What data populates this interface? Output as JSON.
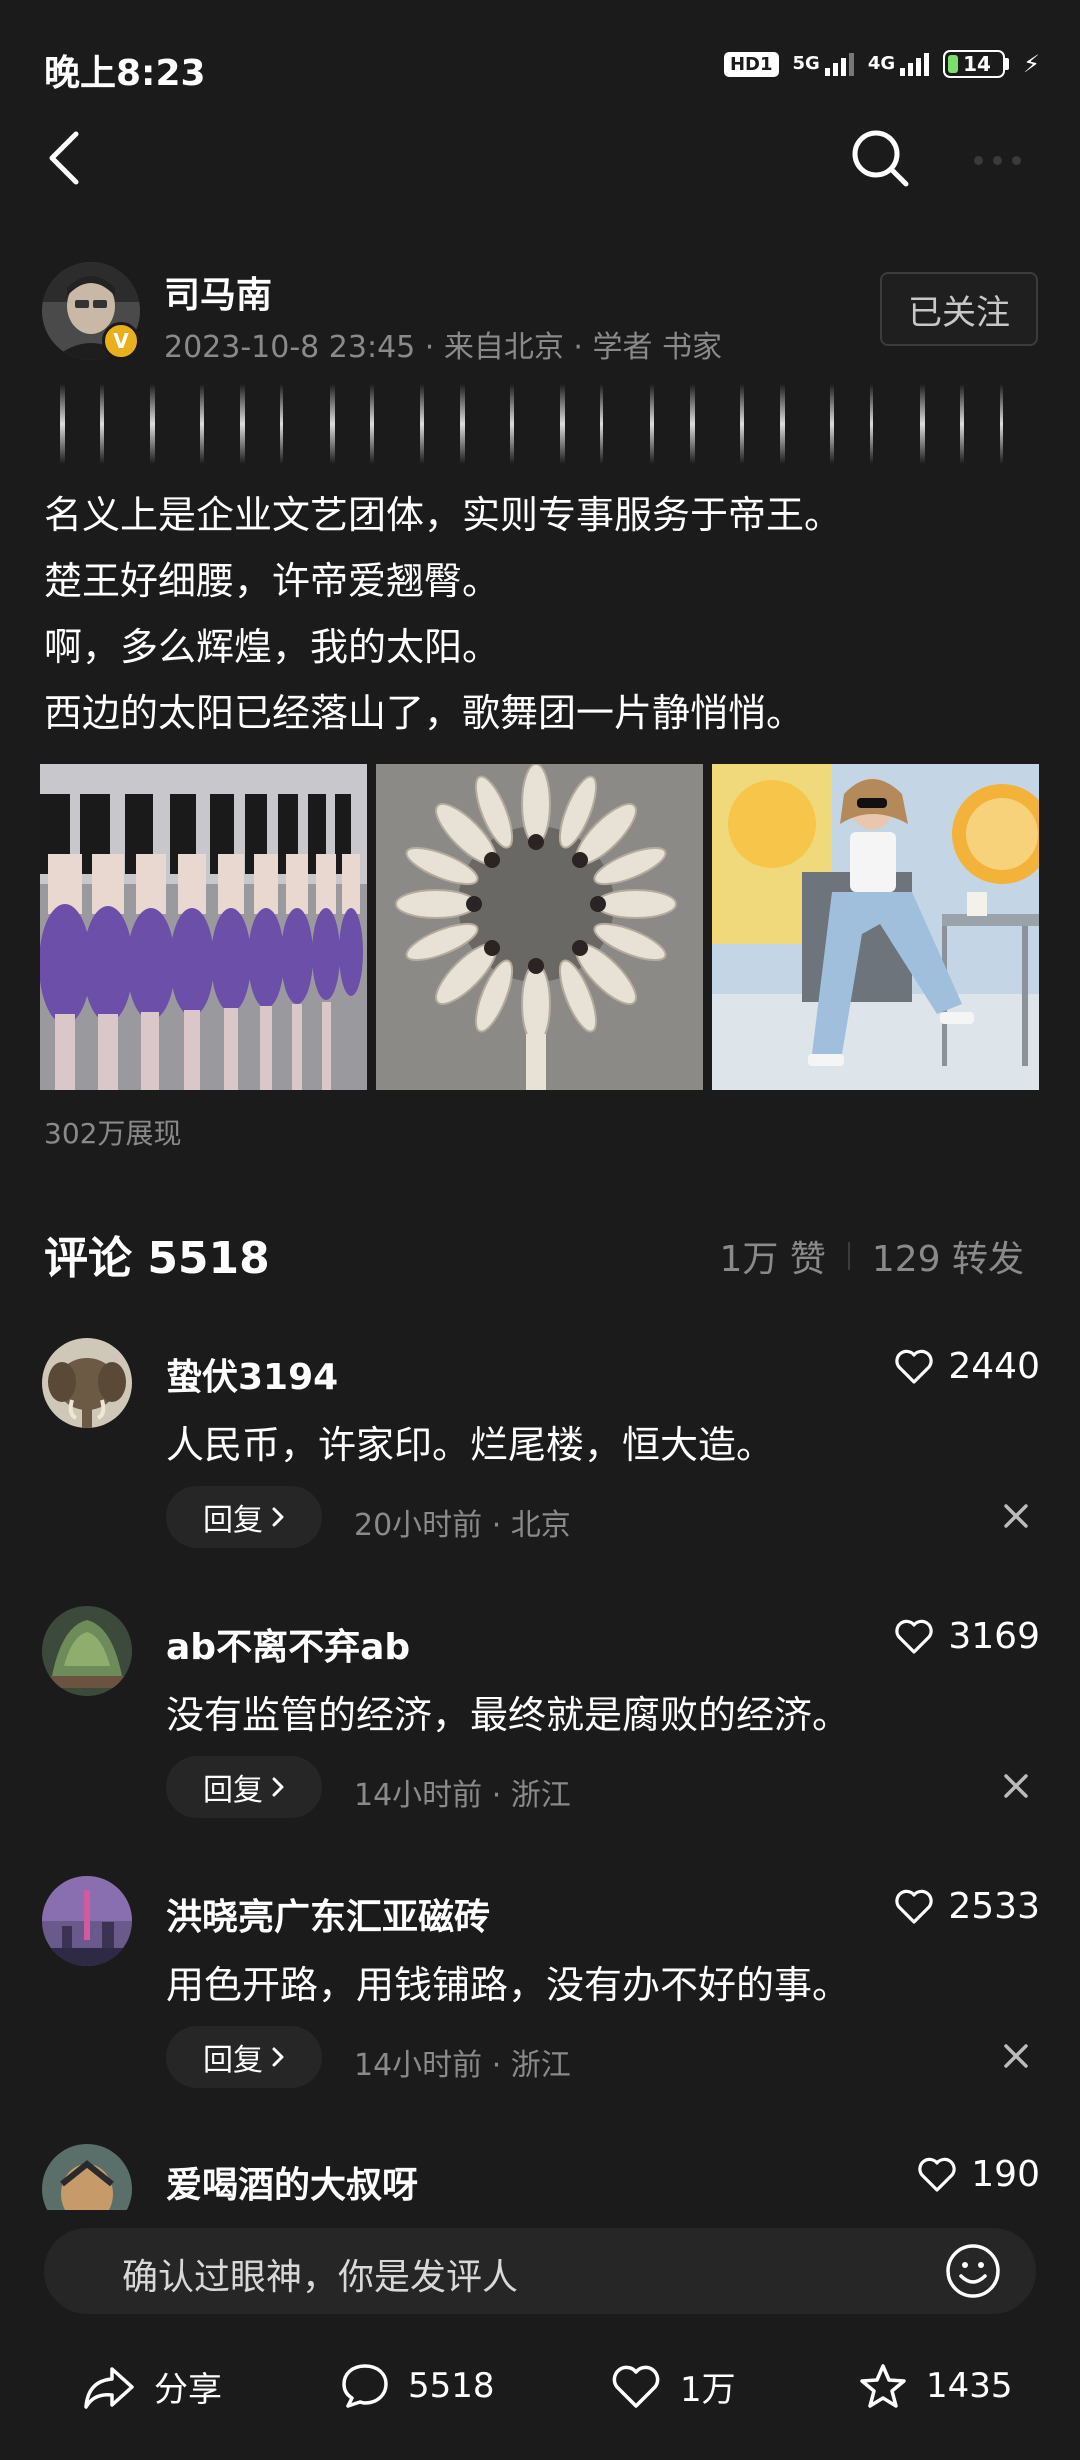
{
  "status_bar": {
    "time": "晚上8:23",
    "hd": "HD1",
    "net1": "5G",
    "net2": "4G",
    "battery": "14"
  },
  "author": {
    "name": "司马南",
    "meta": "2023-10-8 23:45 · 来自北京 · 学者 书家",
    "follow_label": "已关注"
  },
  "post": {
    "lines": [
      "名义上是企业文艺团体，实则专事服务于帝王。",
      "楚王好细腰，许帝爱翘臀。",
      "啊，多么辉煌，我的太阳。",
      "西边的太阳已经落山了，歌舞团一片静悄悄。"
    ],
    "impressions": "302万展现"
  },
  "comments_header": {
    "title": "评论 5518",
    "likes": "1万 赞",
    "reposts": "129 转发"
  },
  "comments": [
    {
      "name": "蛰伏3194",
      "likes": "2440",
      "text": "人民币，许家印。烂尾楼，恒大造。",
      "reply": "回复",
      "time": "20小时前",
      "location": "北京"
    },
    {
      "name": "ab不离不弃ab",
      "likes": "3169",
      "text": "没有监管的经济，最终就是腐败的经济。",
      "reply": "回复",
      "time": "14小时前",
      "location": "浙江"
    },
    {
      "name": "洪晓亮广东汇亚磁砖",
      "likes": "2533",
      "text": "用色开路，用钱铺路，没有办不好的事。",
      "reply": "回复",
      "time": "14小时前",
      "location": "浙江"
    },
    {
      "name": "爱喝酒的大叔呀",
      "likes": "190"
    }
  ],
  "input": {
    "placeholder": "确认过眼神，你是发评人"
  },
  "actions": {
    "share": "分享",
    "comments": "5518",
    "likes": "1万",
    "favorites": "1435"
  },
  "colors": {
    "background": "#1b1b1b",
    "muted_text": "#8a8a8a",
    "verified_badge": "#e9b01e"
  }
}
